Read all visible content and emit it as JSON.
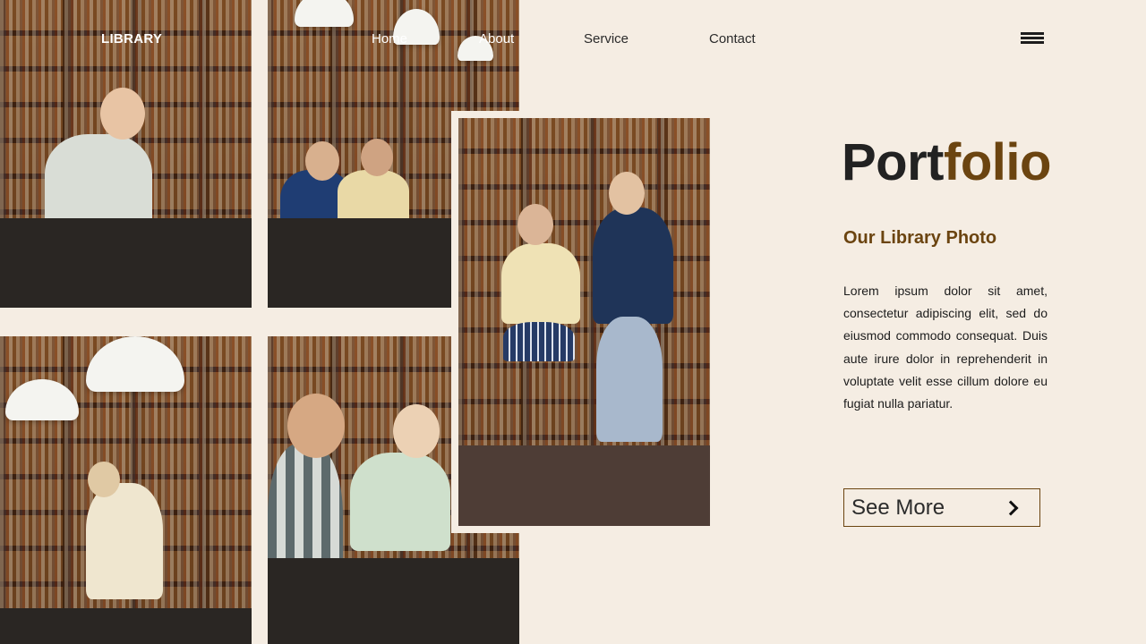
{
  "nav": {
    "brand": "LIBRARY",
    "links": [
      "Home",
      "About",
      "Service",
      "Contact"
    ],
    "menu_icon": "hamburger-menu-icon"
  },
  "hero": {
    "title_part1": "Port",
    "title_part2": "folio",
    "subtitle": "Our Library Photo",
    "body": "Lorem ipsum dolor sit amet, consectetur adipiscing elit, sed do eiusmod commodo consequat. Duis aute irure dolor in reprehenderit in voluptate velit esse cillum dolore eu fugiat nulla pariatur.",
    "cta_label": "See More",
    "cta_icon": "chevron-right-icon"
  },
  "photos": [
    "library-photo-reader",
    "library-photo-students-table",
    "library-photo-shelf-browsing",
    "library-photo-discussion",
    "library-photo-featured-students"
  ],
  "colors": {
    "background": "#f5ede3",
    "accent": "#6b4410",
    "text": "#222222"
  }
}
